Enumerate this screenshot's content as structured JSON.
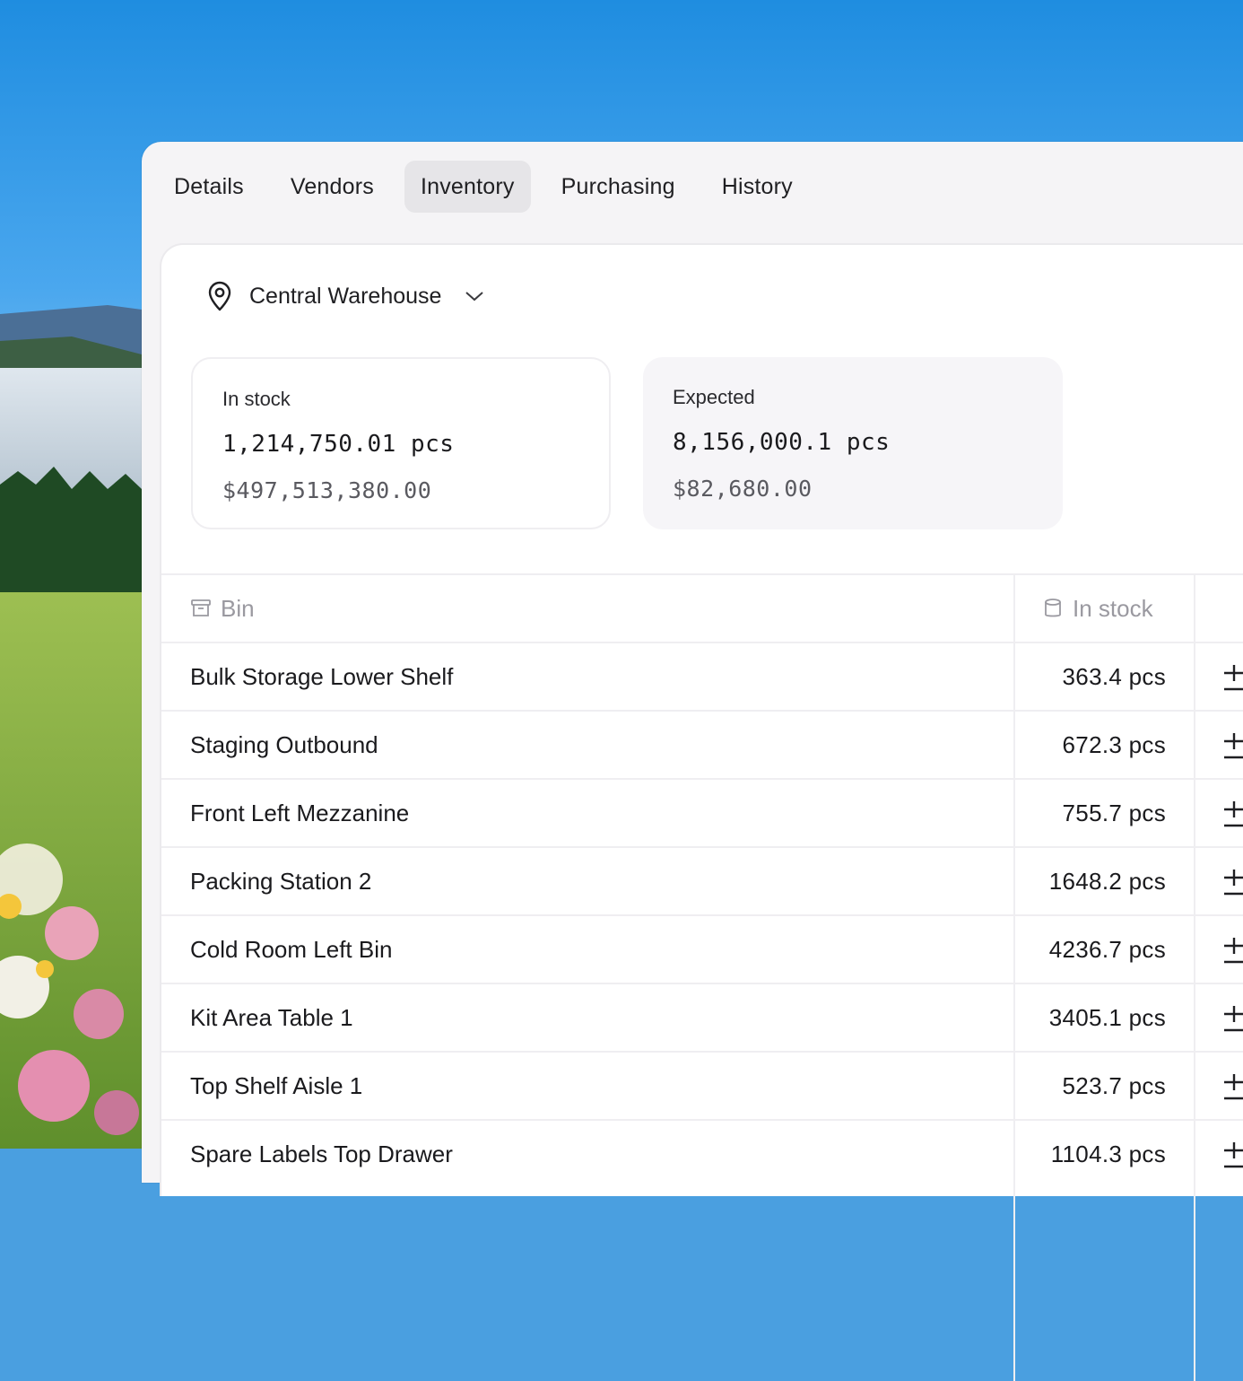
{
  "tabs": [
    {
      "label": "Details",
      "active": false
    },
    {
      "label": "Vendors",
      "active": false
    },
    {
      "label": "Inventory",
      "active": true
    },
    {
      "label": "Purchasing",
      "active": false
    },
    {
      "label": "History",
      "active": false
    }
  ],
  "location": {
    "name": "Central Warehouse",
    "icon": "map-pin-icon"
  },
  "stats": {
    "in_stock": {
      "label": "In stock",
      "quantity": "1,214,750.01 pcs",
      "value": "$497,513,380.00"
    },
    "expected": {
      "label": "Expected",
      "quantity": "8,156,000.1 pcs",
      "value": "$82,680.00"
    }
  },
  "table": {
    "columns": {
      "bin": "Bin",
      "in_stock": "In stock"
    },
    "rows": [
      {
        "bin": "Bulk Storage Lower Shelf",
        "in_stock": "363.4 pcs"
      },
      {
        "bin": "Staging Outbound",
        "in_stock": "672.3 pcs"
      },
      {
        "bin": "Front Left Mezzanine",
        "in_stock": "755.7 pcs"
      },
      {
        "bin": "Packing Station 2",
        "in_stock": "1648.2 pcs"
      },
      {
        "bin": "Cold Room Left Bin",
        "in_stock": "4236.7 pcs"
      },
      {
        "bin": "Kit Area Table 1",
        "in_stock": "3405.1 pcs"
      },
      {
        "bin": "Top Shelf Aisle 1",
        "in_stock": "523.7 pcs"
      },
      {
        "bin": "Spare Labels Top Drawer",
        "in_stock": "1104.3 pcs"
      }
    ]
  },
  "colors": {
    "active_tab_bg": "#e6e5e8",
    "panel_bg": "#f5f4f6",
    "muted_text": "#9a99a0"
  }
}
